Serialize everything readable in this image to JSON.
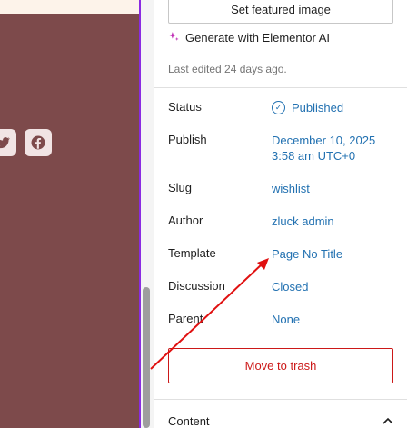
{
  "sidebar": {
    "featured_button": "Set featured image",
    "ai_link": "Generate with Elementor AI",
    "last_edited": "Last edited 24 days ago.",
    "rows": [
      {
        "label": "Status",
        "value": "Published"
      },
      {
        "label": "Publish",
        "value_line1": "December 10, 2025",
        "value_line2": "3:58 am UTC+0"
      },
      {
        "label": "Slug",
        "value": "wishlist"
      },
      {
        "label": "Author",
        "value": "zluck admin"
      },
      {
        "label": "Template",
        "value": "Page No Title"
      },
      {
        "label": "Discussion",
        "value": "Closed"
      },
      {
        "label": "Parent",
        "value": "None"
      }
    ],
    "trash_button": "Move to trash",
    "content_section": "Content"
  },
  "canvas": {
    "social_icons": [
      "twitter-icon",
      "facebook-icon"
    ]
  },
  "colors": {
    "canvas_bg": "#7d4a4b",
    "link": "#2271b1",
    "danger": "#cc1818",
    "accent_purple": "#8a2be2",
    "ai_magenta": "#c02fb6",
    "annotation_arrow": "#e01010"
  }
}
